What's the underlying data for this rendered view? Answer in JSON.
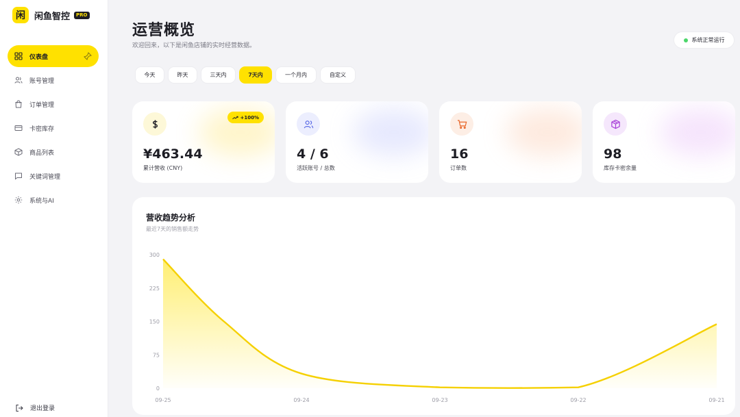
{
  "brand": {
    "logo_glyph": "闲",
    "name": "闲鱼智控",
    "badge": "PRO"
  },
  "sidebar": {
    "items": [
      {
        "label": "仪表盘",
        "icon": "dashboard-icon",
        "active": true
      },
      {
        "label": "账号管理",
        "icon": "users-icon",
        "active": false
      },
      {
        "label": "订单管理",
        "icon": "shopping-bag-icon",
        "active": false
      },
      {
        "label": "卡密库存",
        "icon": "credit-card-icon",
        "active": false
      },
      {
        "label": "商品列表",
        "icon": "package-icon",
        "active": false
      },
      {
        "label": "关键词管理",
        "icon": "message-icon",
        "active": false
      },
      {
        "label": "系统与AI",
        "icon": "gear-icon",
        "active": false
      }
    ],
    "logout_label": "退出登录"
  },
  "header": {
    "title": "运营概览",
    "subtitle": "欢迎回来，以下是闲鱼店铺的实时经营数据。",
    "status_text": "系统正常运行",
    "status_color": "#4cd66a"
  },
  "range_tabs": {
    "items": [
      "今天",
      "昨天",
      "三天内",
      "7天内",
      "一个月内",
      "自定义"
    ],
    "selected": "7天内"
  },
  "stats": [
    {
      "icon": "dollar-icon",
      "value": "¥463.44",
      "label": "累计营收 (CNY)",
      "trend": "+100%",
      "accent": "#e8c300"
    },
    {
      "icon": "users-icon",
      "value": "4 / 6",
      "label": "活跃账号 / 总数",
      "accent": "#6b7cf5"
    },
    {
      "icon": "cart-icon",
      "value": "16",
      "label": "订单数",
      "accent": "#f07a3c"
    },
    {
      "icon": "box-icon",
      "value": "98",
      "label": "库存卡密余量",
      "accent": "#b04de0"
    }
  ],
  "revenue_chart": {
    "title": "营收趋势分析",
    "subtitle": "最近7天的销售额走势"
  },
  "chart_data": {
    "type": "area",
    "x": [
      "09-25",
      "09-24",
      "09-23",
      "09-22",
      "09-21"
    ],
    "y_points": [
      [
        "09-25",
        290
      ],
      [
        "09-24.5",
        150
      ],
      [
        "09-24",
        33
      ],
      [
        "09-23",
        2
      ],
      [
        "09-22",
        2
      ],
      [
        "09-21",
        144
      ]
    ],
    "values": [
      290,
      33,
      2,
      2,
      144
    ],
    "yticks": [
      0,
      75,
      150,
      225,
      300
    ],
    "ylim": [
      0,
      300
    ],
    "color": "#f5d000",
    "grid": false
  }
}
